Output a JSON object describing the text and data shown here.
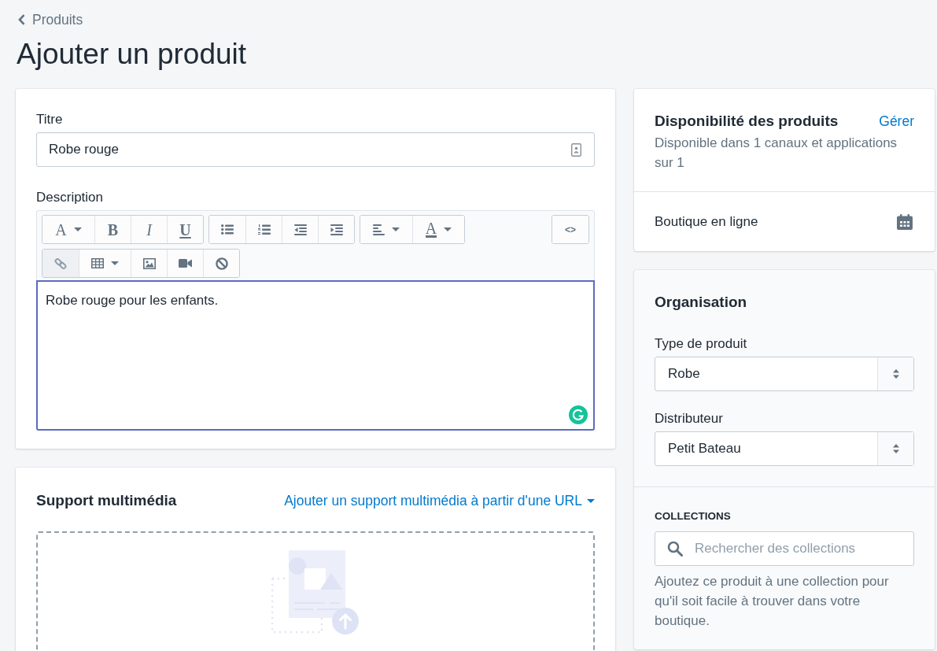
{
  "breadcrumb": {
    "label": "Produits"
  },
  "page_title": "Ajouter un produit",
  "product": {
    "title_field": {
      "label": "Titre",
      "value": "Robe rouge"
    },
    "description": {
      "label": "Description",
      "toolbar": [
        {
          "groups": [
            {
              "buttons": [
                {
                  "kind": "font",
                  "label": "A",
                  "disabled": false
                },
                {
                  "kind": "bold",
                  "label": "B",
                  "disabled": false
                },
                {
                  "kind": "italic",
                  "label": "I",
                  "disabled": false
                },
                {
                  "kind": "underline",
                  "label": "U",
                  "disabled": false
                }
              ]
            },
            {
              "buttons": [
                {
                  "kind": "bullets",
                  "disabled": false
                },
                {
                  "kind": "numbers",
                  "disabled": false
                },
                {
                  "kind": "outdent",
                  "disabled": false
                },
                {
                  "kind": "indent",
                  "disabled": false
                }
              ]
            },
            {
              "buttons": [
                {
                  "kind": "align",
                  "disabled": false
                },
                {
                  "kind": "text-color",
                  "label": "A",
                  "disabled": false
                }
              ]
            }
          ],
          "end_groups": [
            {
              "buttons": [
                {
                  "kind": "source-code",
                  "label": "<>",
                  "disabled": false
                }
              ]
            }
          ]
        },
        {
          "groups": [
            {
              "buttons": [
                {
                  "kind": "link",
                  "disabled": true
                },
                {
                  "kind": "table",
                  "disabled": false
                },
                {
                  "kind": "image",
                  "disabled": false
                },
                {
                  "kind": "video",
                  "disabled": false
                },
                {
                  "kind": "clear",
                  "disabled": false
                }
              ]
            }
          ]
        }
      ],
      "value": "Robe rouge pour les enfants.",
      "focused": true
    }
  },
  "media": {
    "title": "Support multimédia",
    "url_link": "Ajouter un support multimédia à partir d'une URL"
  },
  "availability": {
    "title": "Disponibilité des produits",
    "manage_link": "Gérer",
    "summary": "Disponible dans 1 canaux et applications sur 1",
    "channels": [
      {
        "name": "Boutique en ligne"
      }
    ]
  },
  "organisation": {
    "title": "Organisation",
    "fields": [
      {
        "label": "Type de produit",
        "value": "Robe"
      },
      {
        "label": "Distributeur",
        "value": "Petit Bateau"
      }
    ],
    "collections": {
      "heading": "COLLECTIONS",
      "placeholder": "Rechercher des collections",
      "help": "Ajoutez ce produit à une collection pour qu'il soit facile à trouver dans votre boutique."
    }
  }
}
